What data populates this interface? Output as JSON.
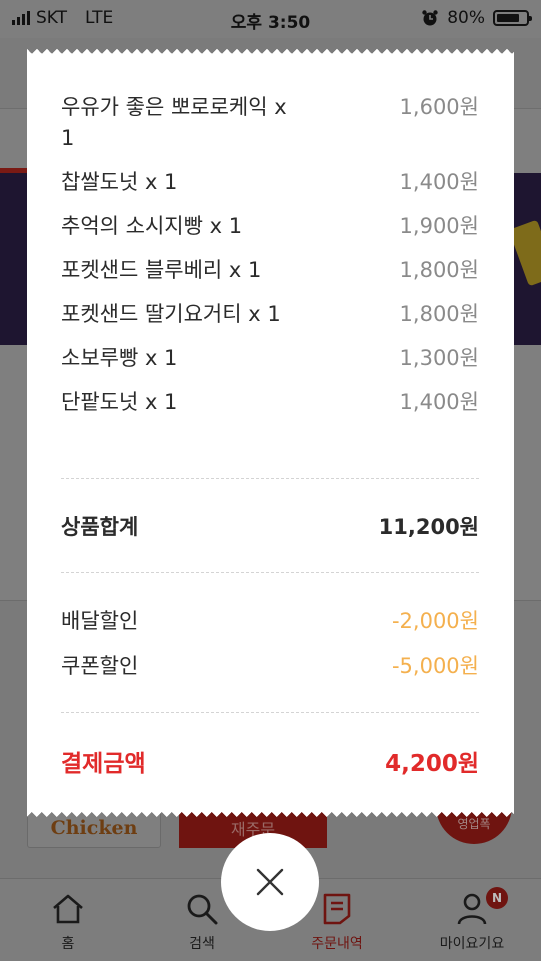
{
  "status_bar": {
    "carrier": "SKT",
    "network": "LTE",
    "time": "오후 3:50",
    "battery_percent": "80%",
    "battery_level": 0.8
  },
  "background": {
    "chicken_label": "Chicken",
    "red_button_label": "재주문",
    "circle_label": "영업폭"
  },
  "receipt": {
    "items": [
      {
        "name": "우유가 좋은 뽀로로케익 x 1",
        "price": "1,600원"
      },
      {
        "name": "찹쌀도넛 x 1",
        "price": "1,400원"
      },
      {
        "name": "추억의 소시지빵 x 1",
        "price": "1,900원"
      },
      {
        "name": "포켓샌드 블루베리 x 1",
        "price": "1,800원"
      },
      {
        "name": "포켓샌드 딸기요거티 x 1",
        "price": "1,800원"
      },
      {
        "name": "소보루빵 x 1",
        "price": "1,300원"
      },
      {
        "name": "단팥도넛 x 1",
        "price": "1,400원"
      }
    ],
    "subtotal": {
      "label": "상품합계",
      "value": "11,200원"
    },
    "discounts": [
      {
        "label": "배달할인",
        "value": "-2,000원"
      },
      {
        "label": "쿠폰할인",
        "value": "-5,000원"
      }
    ],
    "payment": {
      "label": "결제금액",
      "value": "4,200원"
    }
  },
  "nav": {
    "items": [
      {
        "label": "홈",
        "icon": "home-icon"
      },
      {
        "label": "검색",
        "icon": "search-icon"
      },
      {
        "label": "주문내역",
        "icon": "order-list-icon"
      },
      {
        "label": "마이요기요",
        "icon": "user-icon"
      }
    ],
    "badge": "N",
    "active_index": 2
  },
  "colors": {
    "accent": "#e12a2a",
    "discount": "#f4b04e",
    "dim_overlay": "#7f7f7f"
  }
}
